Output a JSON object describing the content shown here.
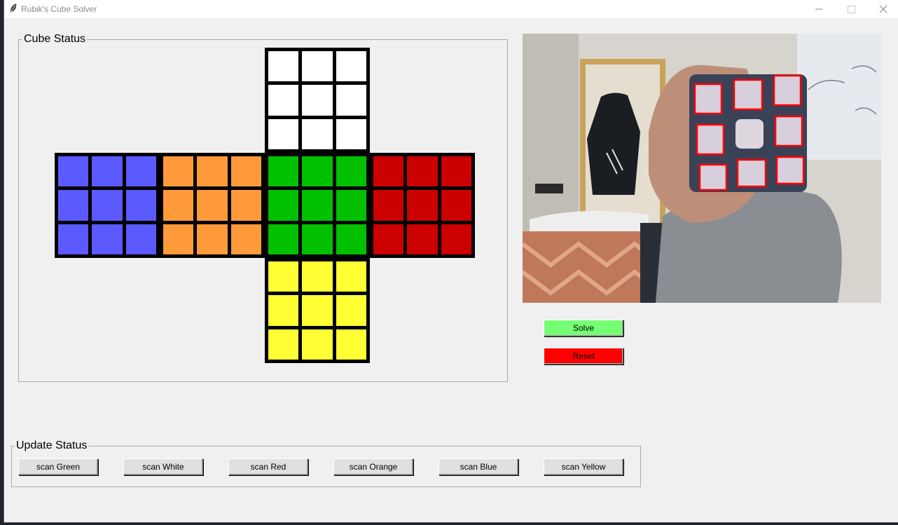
{
  "window": {
    "title": "Rubik's Cube Solver",
    "icon": "feather-icon",
    "controls": [
      "minimize-icon",
      "maximize-icon",
      "close-icon"
    ]
  },
  "cube_status": {
    "label": "Cube Status",
    "faces": {
      "up": [
        "#ffffff",
        "#ffffff",
        "#ffffff",
        "#ffffff",
        "#ffffff",
        "#ffffff",
        "#ffffff",
        "#ffffff",
        "#ffffff"
      ],
      "left": [
        "#5a5aff",
        "#5a5aff",
        "#5a5aff",
        "#5a5aff",
        "#5a5aff",
        "#5a5aff",
        "#5a5aff",
        "#5a5aff",
        "#5a5aff"
      ],
      "front_left": [
        "#ff9a3a",
        "#ff9a3a",
        "#ff9a3a",
        "#ff9a3a",
        "#ff9a3a",
        "#ff9a3a",
        "#ff9a3a",
        "#ff9a3a",
        "#ff9a3a"
      ],
      "front": [
        "#00c000",
        "#00c000",
        "#00c000",
        "#00c000",
        "#00c000",
        "#00c000",
        "#00c000",
        "#00c000",
        "#00c000"
      ],
      "right": [
        "#cc0000",
        "#cc0000",
        "#cc0000",
        "#cc0000",
        "#cc0000",
        "#cc0000",
        "#cc0000",
        "#cc0000",
        "#cc0000"
      ],
      "down": [
        "#ffff33",
        "#ffff33",
        "#ffff33",
        "#ffff33",
        "#ffff33",
        "#ffff33",
        "#ffff33",
        "#ffff33",
        "#ffff33"
      ]
    }
  },
  "camera": {
    "detected_stickers": 9
  },
  "actions": {
    "solve_label": "Solve",
    "solve_color": "#74ff74",
    "reset_label": "Reset",
    "reset_color": "#ff0000"
  },
  "update_status": {
    "label": "Update Status",
    "buttons": [
      "scan Green",
      "scan White",
      "scan Red",
      "scan Orange",
      "scan Blue",
      "scan Yellow"
    ]
  }
}
